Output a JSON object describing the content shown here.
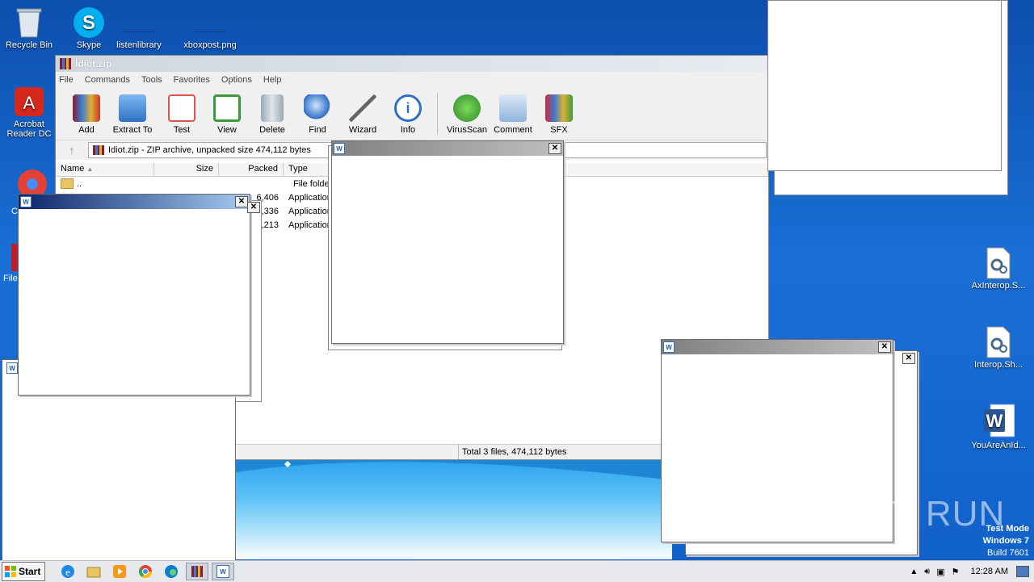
{
  "desktop": {
    "icons_left": [
      {
        "label": "Recycle Bin",
        "icon": "recycle-bin-icon"
      },
      {
        "label": "Skype",
        "icon": "skype-icon"
      },
      {
        "label": "listenlibrary",
        "icon": "file-icon"
      },
      {
        "label": "xboxpost.png",
        "icon": "image-icon"
      },
      {
        "label": "Acrobat Reader DC",
        "icon": "acrobat-icon"
      },
      {
        "label": "C",
        "icon": "chrome-icon"
      },
      {
        "label": "File",
        "icon": "winrar-icon"
      }
    ],
    "icons_right": [
      {
        "label": "AxInterop.S...",
        "icon": "dll-gear-icon"
      },
      {
        "label": "Interop.Sh...",
        "icon": "dll-gear-icon"
      },
      {
        "label": "YouAreAnId...",
        "icon": "word-doc-icon"
      }
    ],
    "watermark": "ANY RUN",
    "test_mode": {
      "line1": "Test Mode",
      "line2": "Windows 7",
      "line3": "Build 7601"
    }
  },
  "winrar": {
    "title": "Idiot.zip",
    "menu": [
      "File",
      "Commands",
      "Tools",
      "Favorites",
      "Options",
      "Help"
    ],
    "toolbar": [
      {
        "label": "Add",
        "color": "#c0392b"
      },
      {
        "label": "Extract To",
        "color": "#4a90d9"
      },
      {
        "label": "Test",
        "color": "#d9534f"
      },
      {
        "label": "View",
        "color": "#3c9a3c"
      },
      {
        "label": "Delete",
        "color": "#8a9aa8"
      },
      {
        "label": "Find",
        "color": "#2f6fc4"
      },
      {
        "label": "Wizard",
        "color": "#d8d8d8"
      },
      {
        "label": "Info",
        "color": "#2f6fc4"
      },
      {
        "label": "VirusScan",
        "color": "#3aa63a"
      },
      {
        "label": "Comment",
        "color": "#8fb4dc"
      },
      {
        "label": "SFX",
        "color": "#e0a030"
      }
    ],
    "path": "Idiot.zip - ZIP archive, unpacked size 474,112 bytes",
    "columns": [
      "Name",
      "Size",
      "Packed",
      "Type"
    ],
    "rows": [
      {
        "name": "..",
        "packed": "",
        "type": "File folder"
      },
      {
        "name": "",
        "packed": "6,406",
        "type": "Application"
      },
      {
        "name": "",
        "packed": ",336",
        "type": "Application"
      },
      {
        "name": "",
        "packed": ",213",
        "type": "Application"
      }
    ],
    "status": "Total 3 files, 474,112 bytes"
  },
  "popups": {
    "close_glyph": "✕",
    "word_glyph": "W"
  },
  "taskbar": {
    "start_label": "Start",
    "clock": "12:28 AM",
    "items": [
      "ie-icon",
      "explorer-icon",
      "media-player-icon",
      "chrome-icon",
      "edge-icon",
      "winrar-icon",
      "word-icon"
    ]
  }
}
